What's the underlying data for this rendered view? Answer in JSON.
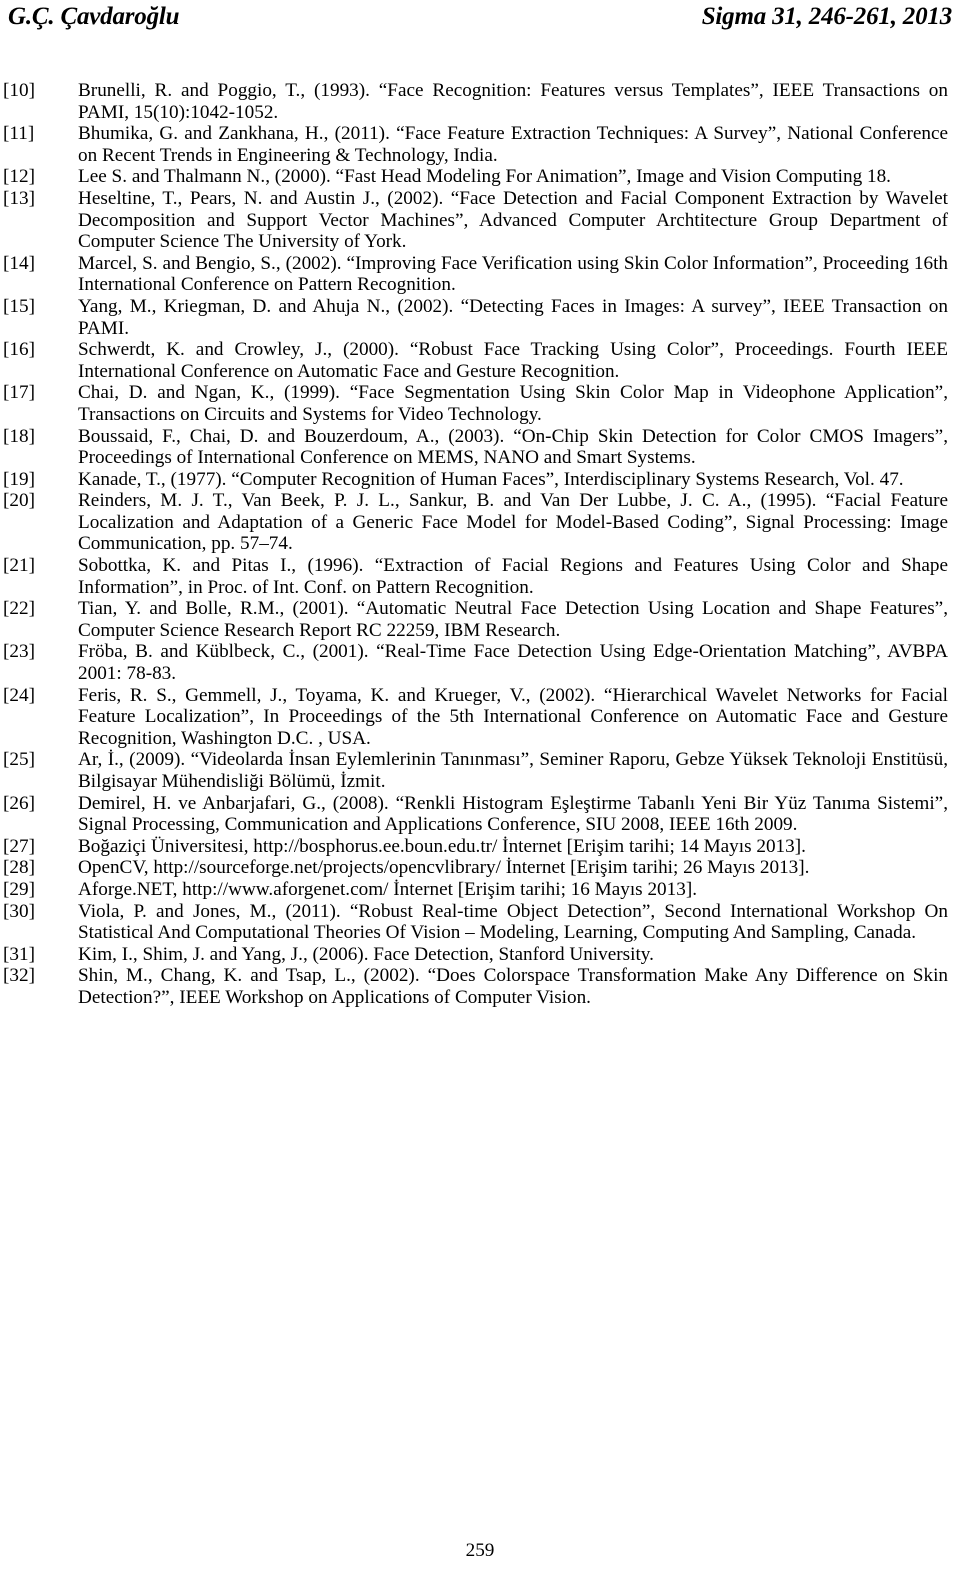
{
  "header": {
    "left": "G.Ç. Çavdaroğlu",
    "right": "Sigma 31, 246-261, 2013"
  },
  "references": [
    {
      "num": "[10]",
      "text": "Brunelli, R. and Poggio, T., (1993). “Face Recognition: Features versus Templates”, IEEE Transactions on PAMI, 15(10):1042-1052."
    },
    {
      "num": "[11]",
      "text": "Bhumika, G. and Zankhana, H., (2011). “Face Feature Extraction Techniques: A Survey”, National Conference on Recent Trends in Engineering & Technology, India."
    },
    {
      "num": "[12]",
      "text": "Lee S. and Thalmann N., (2000). “Fast Head Modeling For Animation”, Image and Vision Computing 18."
    },
    {
      "num": "[13]",
      "text": "Heseltine, T., Pears, N. and Austin J., (2002). “Face Detection and Facial Component Extraction by Wavelet Decomposition and Support Vector Machines”, Advanced Computer Archtitecture Group Department of Computer Science The University of York."
    },
    {
      "num": "[14]",
      "text": "Marcel, S. and Bengio, S., (2002). “Improving Face Verification using Skin Color Information”, Proceeding 16th International Conference on Pattern Recognition."
    },
    {
      "num": "[15]",
      "text": "Yang, M., Kriegman, D. and Ahuja N., (2002). “Detecting Faces in Images: A survey”, IEEE Transaction on PAMI."
    },
    {
      "num": "[16]",
      "text": "Schwerdt, K. and Crowley, J., (2000). “Robust Face Tracking Using Color”, Proceedings. Fourth IEEE International Conference on Automatic Face and Gesture Recognition."
    },
    {
      "num": "[17]",
      "text": "Chai, D. and Ngan, K., (1999). “Face Segmentation Using Skin Color Map in Videophone Application”, Transactions on Circuits and Systems for Video Technology."
    },
    {
      "num": "[18]",
      "text": "Boussaid, F., Chai, D. and Bouzerdoum, A., (2003). “On-Chip Skin Detection for Color CMOS Imagers”, Proceedings of International Conference on MEMS, NANO and Smart Systems."
    },
    {
      "num": "[19]",
      "text": "Kanade, T., (1977). “Computer Recognition of Human Faces”, Interdisciplinary Systems Research, Vol. 47."
    },
    {
      "num": "[20]",
      "text": "Reinders, M. J. T., Van Beek, P. J. L., Sankur, B. and Van Der Lubbe, J. C. A., (1995). “Facial Feature Localization and Adaptation of a Generic Face Model for Model-Based Coding”, Signal Processing: Image Communication, pp. 57–74."
    },
    {
      "num": "[21]",
      "text": "Sobottka, K. and Pitas I., (1996). “Extraction of Facial Regions and Features Using Color and Shape Information”, in Proc. of Int. Conf. on Pattern Recognition."
    },
    {
      "num": "[22]",
      "text": "Tian, Y. and Bolle, R.M., (2001). “Automatic Neutral Face Detection Using Location and Shape Features”, Computer Science Research Report RC 22259, IBM Research."
    },
    {
      "num": "[23]",
      "text": "Fröba, B. and Küblbeck, C., (2001). “Real-Time Face Detection Using Edge-Orientation Matching”, AVBPA 2001: 78-83."
    },
    {
      "num": "[24]",
      "text": "Feris, R. S., Gemmell, J., Toyama, K. and Krueger, V., (2002). “Hierarchical Wavelet Networks for Facial Feature Localization”, In Proceedings of the 5th International Conference on Automatic Face and Gesture Recognition, Washington D.C. , USA."
    },
    {
      "num": "[25]",
      "text": "Ar, İ., (2009). “Videolarda İnsan Eylemlerinin Tanınması”, Seminer Raporu, Gebze Yüksek Teknoloji Enstitüsü, Bilgisayar Mühendisliği Bölümü, İzmit."
    },
    {
      "num": "[26]",
      "text": "Demirel, H. ve Anbarjafari, G., (2008). “Renkli Histogram Eşleştirme Tabanlı Yeni Bir Yüz Tanıma Sistemi”, Signal Processing, Communication and Applications Conference, SIU 2008, IEEE 16th 2009."
    },
    {
      "num": "[27]",
      "text": "Boğaziçi Üniversitesi, http://bosphorus.ee.boun.edu.tr/ İnternet [Erişim tarihi; 14 Mayıs 2013]."
    },
    {
      "num": "[28]",
      "text": "OpenCV, http://sourceforge.net/projects/opencvlibrary/ İnternet [Erişim tarihi; 26 Mayıs 2013]."
    },
    {
      "num": "[29]",
      "text": "Aforge.NET, http://www.aforgenet.com/ İnternet [Erişim tarihi; 16 Mayıs 2013]."
    },
    {
      "num": "[30]",
      "text": "Viola, P. and Jones, M., (2011). “Robust Real-time Object Detection”, Second International Workshop On Statistical And Computational Theories Of Vision – Modeling, Learning, Computing And Sampling, Canada."
    },
    {
      "num": "[31]",
      "text": "Kim, I., Shim, J. and Yang, J., (2006). Face Detection, Stanford University."
    },
    {
      "num": "[32]",
      "text": "Shin, M., Chang, K. and Tsap, L., (2002). “Does Colorspace Transformation Make Any Difference on Skin Detection?”, IEEE Workshop on Applications of Computer Vision."
    }
  ],
  "folio": {
    "page_number": "259"
  }
}
